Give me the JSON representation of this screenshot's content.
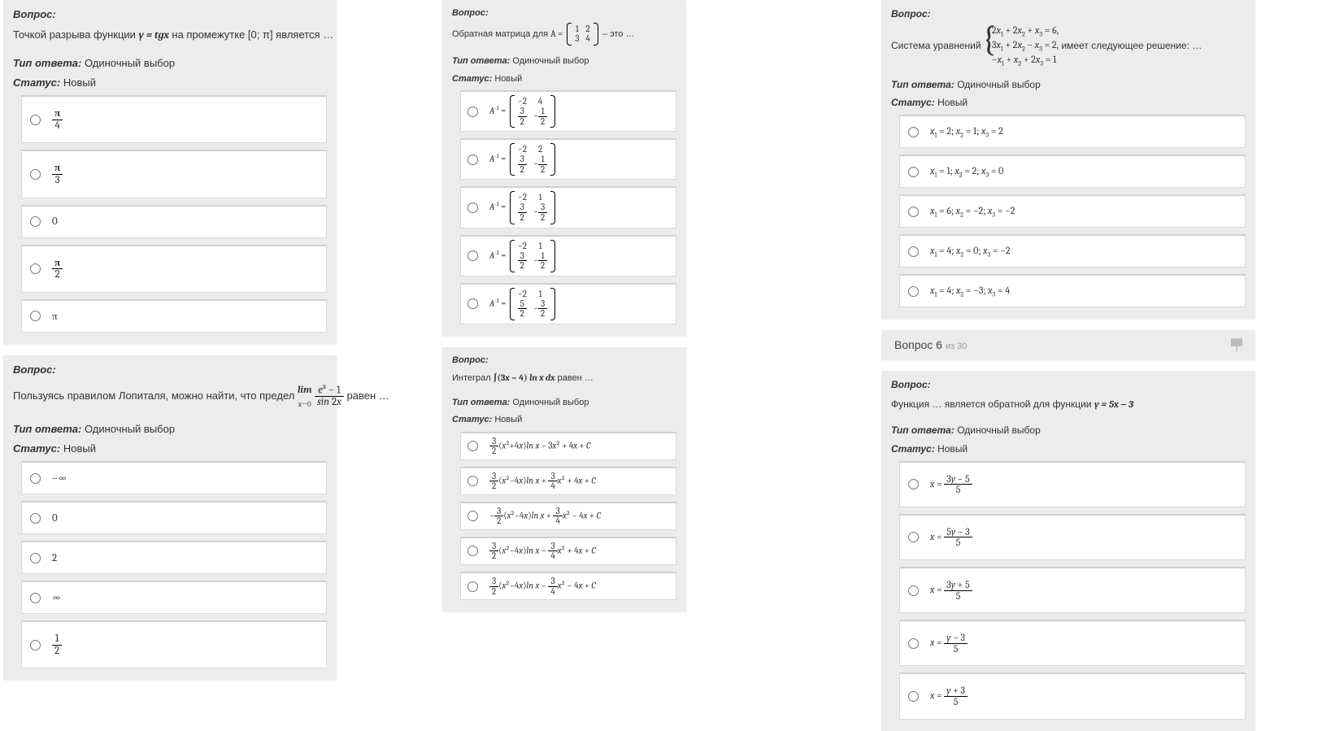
{
  "labels": {
    "question": "Вопрос:",
    "answerType": "Тип ответа:",
    "singleChoice": "Одиночный выбор",
    "status": "Статус:",
    "statusNew": "Новый"
  },
  "col1": {
    "q1": {
      "pre": "Точкой разрыва функции ",
      "formula": "y = tgx",
      "post": " на промежутке [0; π] является …",
      "options": [
        "π/4",
        "π/3",
        "0",
        "π/2",
        "π"
      ]
    },
    "q2": {
      "pre": "Пользуясь правилом Лопиталя, можно найти, что предел ",
      "formula": "lim_{x→0} (e^x − 1) / sin 2x",
      "post": " равен …",
      "options": [
        "−∞",
        "0",
        "2",
        "∞",
        "1/2"
      ]
    }
  },
  "col2": {
    "q1": {
      "pre": "Обратная матрица для ",
      "matrix": [
        [
          "1",
          "2"
        ],
        [
          "3",
          "4"
        ]
      ],
      "post": " – это …",
      "options": [
        [
          [
            "-2",
            "4"
          ],
          [
            "3/2",
            "-1/2"
          ]
        ],
        [
          [
            "-2",
            "2"
          ],
          [
            "3/2",
            "-1/2"
          ]
        ],
        [
          [
            "-2",
            "1"
          ],
          [
            "3/2",
            "-3/2"
          ]
        ],
        [
          [
            "-2",
            "1"
          ],
          [
            "3/2",
            "-1/2"
          ]
        ],
        [
          [
            "-2",
            "1"
          ],
          [
            "5/2",
            "-3/2"
          ]
        ]
      ]
    },
    "q2": {
      "pre": "Интеграл ",
      "formula": "∫(3x − 4) ln x dx",
      "post": " равен …",
      "options": [
        "3/2 (x² + 4x) ln x − 3x² + 4x + C",
        "3/2 (x² − 4x) ln x + 3/4 x² + 4x + C",
        "−3/2 (x² − 4x) ln x + 3/4 x² − 4x + C",
        "3/2 (x² − 4x) ln x − 3/4 x² + 4x + C",
        "3/2 (x² − 4x) ln x − 3/4 x² − 4x + C"
      ]
    }
  },
  "col3": {
    "q1": {
      "pre": "Система уравнений ",
      "system": [
        "2x₁ + 2x₂ + x₃ = 6,",
        "3x₁ + 2x₂ − x₃ = 2,",
        "−x₁ + x₂ + 2x₃ = 1"
      ],
      "post": " имеет следующее решение: …",
      "options": [
        "x₁ = 2;  x₂ = 1;  x₃ = 2",
        "x₁ = 1;  x₂ = 2;  x₃ = 0",
        "x₁ = 6;  x₂ = −2;  x₃ = −2",
        "x₁ = 4;  x₂ = 0;  x₃ = −2",
        "x₁ = 4;  x₂ = −3;  x₃ = 4"
      ]
    },
    "nav": {
      "label": "Вопрос 6",
      "of": "из 30"
    },
    "q2": {
      "pre": "Функция … является обратной для функции ",
      "formula": "y = 5x − 3",
      "options": [
        "x = (3y − 5) / 5",
        "x = (5y − 3) / 5",
        "x = (3y + 5) / 5",
        "x = (y − 3) / 5",
        "x = (y + 3) / 5"
      ]
    }
  }
}
